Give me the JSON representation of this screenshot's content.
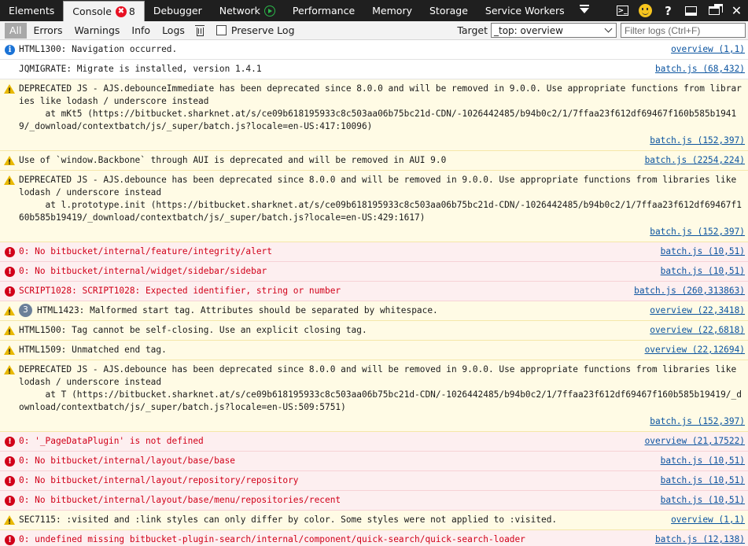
{
  "tabs": [
    {
      "label": "Elements"
    },
    {
      "label": "Console",
      "error_badge": "✖",
      "error_count": "8",
      "active": true
    },
    {
      "label": "Debugger"
    },
    {
      "label": "Network",
      "icon": "play-icon"
    },
    {
      "label": "Performance"
    },
    {
      "label": "Memory"
    },
    {
      "label": "Storage"
    },
    {
      "label": "Service Workers"
    }
  ],
  "toolbar_icons": {
    "console_glyph": ">_",
    "help": "?",
    "close": "✕"
  },
  "filters": [
    "All",
    "Errors",
    "Warnings",
    "Info",
    "Logs"
  ],
  "preserve_log_label": "Preserve Log",
  "target": {
    "label": "Target",
    "value": "_top: overview"
  },
  "filter_input": {
    "placeholder": "Filter logs (Ctrl+F)",
    "value": ""
  },
  "colors": {
    "error_text": "#d10019",
    "warn_bg": "#fffbe5",
    "error_bg": "#fdeff0",
    "link": "#0b54a0"
  },
  "messages": [
    {
      "level": "info",
      "icon": "info-icon",
      "text": "HTML1300: Navigation occurred.",
      "source": "overview (1,1)"
    },
    {
      "level": "log",
      "icon": "",
      "text": "JQMIGRATE: Migrate is installed, version 1.4.1",
      "source": "batch.js (68,432)"
    },
    {
      "level": "warn",
      "icon": "warning-icon",
      "multi": true,
      "text": "DEPRECATED JS - AJS.debounceImmediate has been deprecated since 8.0.0 and will be removed in 9.0.0. Use appropriate functions from libraries like lodash / underscore instead\n     at mKt5 (https://bitbucket.sharknet.at/s/ce09b618195933c8c503aa06b75bc21d-CDN/-1026442485/b94b0c2/1/7ffaa23f612df69467f160b585b19419/_download/contextbatch/js/_super/batch.js?locale=en-US:417:10096)",
      "source": "batch.js (152,397)"
    },
    {
      "level": "warn",
      "icon": "warning-icon",
      "text": "Use of `window.Backbone` through AUI is deprecated and will be removed in AUI 9.0",
      "source": "batch.js (2254,224)"
    },
    {
      "level": "warn",
      "icon": "warning-icon",
      "multi": true,
      "text": "DEPRECATED JS - AJS.debounce has been deprecated since 8.0.0 and will be removed in 9.0.0. Use appropriate functions from libraries like lodash / underscore instead\n     at l.prototype.init (https://bitbucket.sharknet.at/s/ce09b618195933c8c503aa06b75bc21d-CDN/-1026442485/b94b0c2/1/7ffaa23f612df69467f160b585b19419/_download/contextbatch/js/_super/batch.js?locale=en-US:429:1617)",
      "source": "batch.js (152,397)"
    },
    {
      "level": "error",
      "icon": "error-icon",
      "text": "0: No bitbucket/internal/feature/integrity/alert",
      "source": "batch.js (10,51)"
    },
    {
      "level": "error",
      "icon": "error-icon",
      "text": "0: No bitbucket/internal/widget/sidebar/sidebar",
      "source": "batch.js (10,51)"
    },
    {
      "level": "error",
      "icon": "error-icon",
      "text": "SCRIPT1028: SCRIPT1028: Expected identifier, string or number",
      "source": "batch.js (260,313863)"
    },
    {
      "level": "warn",
      "icon": "warning-icon",
      "count": "3",
      "text": "HTML1423: Malformed start tag. Attributes should be separated by whitespace.",
      "source": "overview (22,3418)"
    },
    {
      "level": "warn",
      "icon": "warning-icon",
      "text": "HTML1500: Tag cannot be self-closing. Use an explicit closing tag.",
      "source": "overview (22,6818)"
    },
    {
      "level": "warn",
      "icon": "warning-icon",
      "text": "HTML1509: Unmatched end tag.",
      "source": "overview (22,12694)"
    },
    {
      "level": "warn",
      "icon": "warning-icon",
      "multi": true,
      "text": "DEPRECATED JS - AJS.debounce has been deprecated since 8.0.0 and will be removed in 9.0.0. Use appropriate functions from libraries like lodash / underscore instead\n     at T (https://bitbucket.sharknet.at/s/ce09b618195933c8c503aa06b75bc21d-CDN/-1026442485/b94b0c2/1/7ffaa23f612df69467f160b585b19419/_download/contextbatch/js/_super/batch.js?locale=en-US:509:5751)",
      "source": "batch.js (152,397)"
    },
    {
      "level": "error",
      "icon": "error-icon",
      "text": "0: '_PageDataPlugin' is not defined",
      "source": "overview (21,17522)"
    },
    {
      "level": "error",
      "icon": "error-icon",
      "text": "0: No bitbucket/internal/layout/base/base",
      "source": "batch.js (10,51)"
    },
    {
      "level": "error",
      "icon": "error-icon",
      "text": "0: No bitbucket/internal/layout/repository/repository",
      "source": "batch.js (10,51)"
    },
    {
      "level": "error",
      "icon": "error-icon",
      "text": "0: No bitbucket/internal/layout/base/menu/repositories/recent",
      "source": "batch.js (10,51)"
    },
    {
      "level": "warn",
      "icon": "warning-icon",
      "text": "SEC7115: :visited and :link styles can only differ by color. Some styles were not applied to :visited.",
      "source": "overview (1,1)"
    },
    {
      "level": "error",
      "icon": "error-icon",
      "text": "0: undefined missing bitbucket-plugin-search/internal/component/quick-search/quick-search-loader",
      "source": "batch.js (12,138)"
    }
  ]
}
